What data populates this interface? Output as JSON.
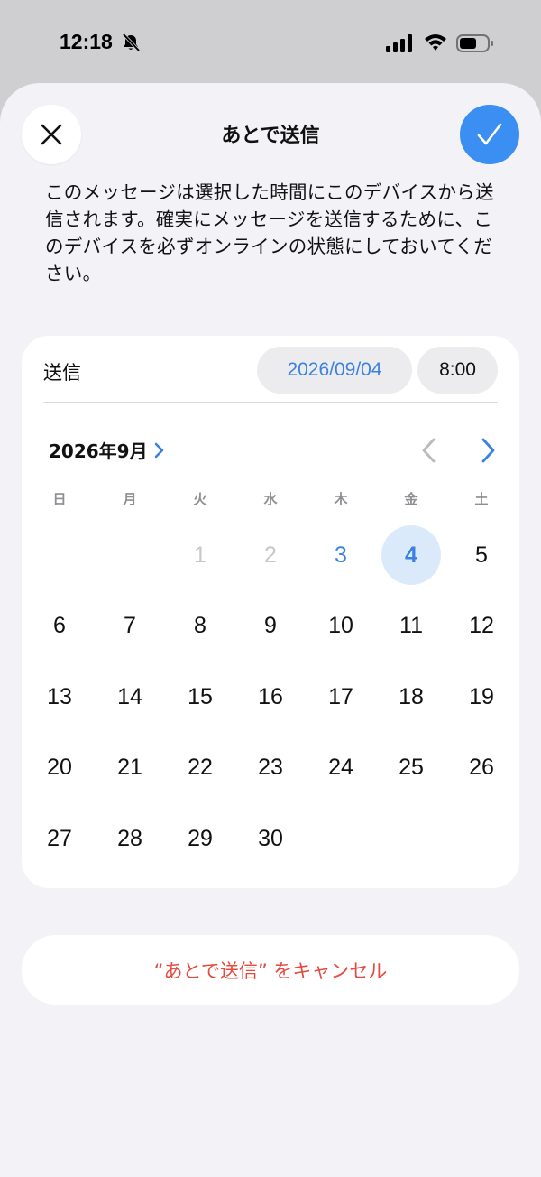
{
  "status_bar": {
    "time": "12:18",
    "icons": [
      "bell-slash-icon",
      "cellular-signal-icon",
      "wifi-icon",
      "battery-icon"
    ]
  },
  "sheet": {
    "title": "あとで送信",
    "description": "このメッセージは選択した時間にこのデバイスから送信されます。確実にメッセージを送信するために、このデバイスを必ずオンラインの状態にしておいてください。",
    "close_icon": "xmark-icon",
    "confirm_icon": "checkmark-icon"
  },
  "scheduler": {
    "send_label": "送信",
    "date_value": "2026/09/04",
    "time_value": "8:00",
    "month_label": "2026年9月",
    "weekdays": [
      "日",
      "月",
      "火",
      "水",
      "木",
      "金",
      "土"
    ],
    "days": [
      {
        "label": "",
        "state": "empty"
      },
      {
        "label": "",
        "state": "empty"
      },
      {
        "label": "1",
        "state": "past"
      },
      {
        "label": "2",
        "state": "past"
      },
      {
        "label": "3",
        "state": "today"
      },
      {
        "label": "4",
        "state": "selected"
      },
      {
        "label": "5",
        "state": "normal"
      },
      {
        "label": "6",
        "state": "normal"
      },
      {
        "label": "7",
        "state": "normal"
      },
      {
        "label": "8",
        "state": "normal"
      },
      {
        "label": "9",
        "state": "normal"
      },
      {
        "label": "10",
        "state": "normal"
      },
      {
        "label": "11",
        "state": "normal"
      },
      {
        "label": "12",
        "state": "normal"
      },
      {
        "label": "13",
        "state": "normal"
      },
      {
        "label": "14",
        "state": "normal"
      },
      {
        "label": "15",
        "state": "normal"
      },
      {
        "label": "16",
        "state": "normal"
      },
      {
        "label": "17",
        "state": "normal"
      },
      {
        "label": "18",
        "state": "normal"
      },
      {
        "label": "19",
        "state": "normal"
      },
      {
        "label": "20",
        "state": "normal"
      },
      {
        "label": "21",
        "state": "normal"
      },
      {
        "label": "22",
        "state": "normal"
      },
      {
        "label": "23",
        "state": "normal"
      },
      {
        "label": "24",
        "state": "normal"
      },
      {
        "label": "25",
        "state": "normal"
      },
      {
        "label": "26",
        "state": "normal"
      },
      {
        "label": "27",
        "state": "normal"
      },
      {
        "label": "28",
        "state": "normal"
      },
      {
        "label": "29",
        "state": "normal"
      },
      {
        "label": "30",
        "state": "normal"
      }
    ]
  },
  "cancel_button": {
    "label": "“あとで送信” をキャンセル"
  },
  "colors": {
    "accent": "#3b82e0",
    "confirm_bg": "#3b8ef2",
    "destructive": "#e5493f",
    "selected_bg": "#dbeafa"
  }
}
